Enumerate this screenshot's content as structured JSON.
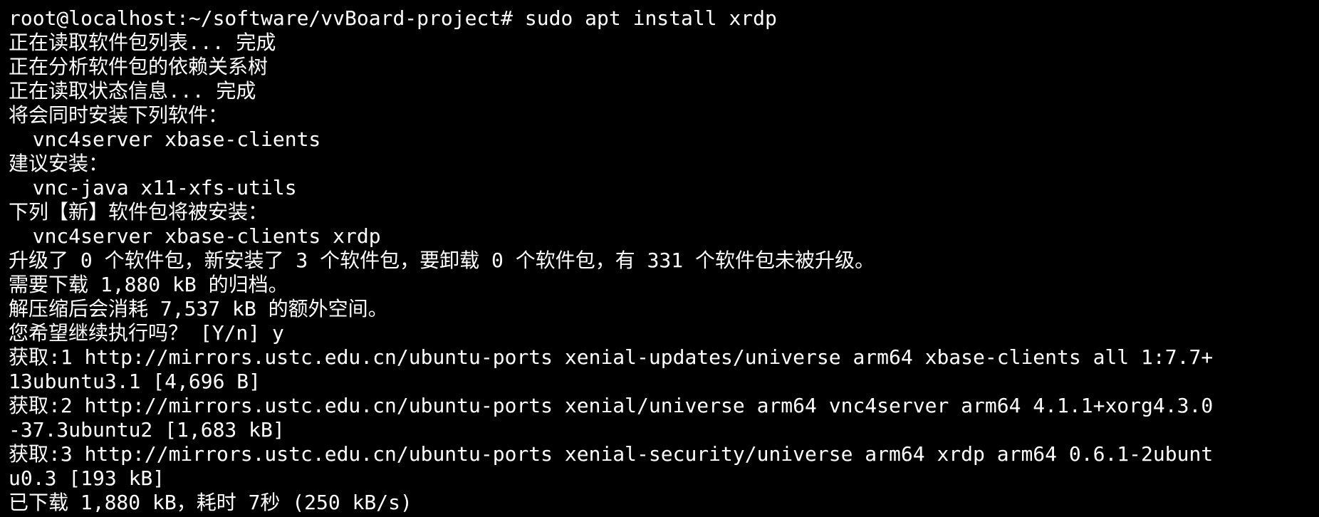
{
  "terminal": {
    "background_color": "#000000",
    "text_color": "#ffffff",
    "lines": [
      "root@localhost:~/software/vvBoard-project# sudo apt install xrdp",
      "正在读取软件包列表... 完成",
      "正在分析软件包的依赖关系树",
      "正在读取状态信息... 完成",
      "将会同时安装下列软件：",
      "  vnc4server xbase-clients",
      "建议安装：",
      "  vnc-java x11-xfs-utils",
      "下列【新】软件包将被安装：",
      "  vnc4server xbase-clients xrdp",
      "升级了 0 个软件包，新安装了 3 个软件包，要卸载 0 个软件包，有 331 个软件包未被升级。",
      "需要下载 1,880 kB 的归档。",
      "解压缩后会消耗 7,537 kB 的额外空间。",
      "您希望继续执行吗？ [Y/n] y",
      "获取:1 http://mirrors.ustc.edu.cn/ubuntu-ports xenial-updates/universe arm64 xbase-clients all 1:7.7+",
      "13ubuntu3.1 [4,696 B]",
      "获取:2 http://mirrors.ustc.edu.cn/ubuntu-ports xenial/universe arm64 vnc4server arm64 4.1.1+xorg4.3.0",
      "-37.3ubuntu2 [1,683 kB]",
      "获取:3 http://mirrors.ustc.edu.cn/ubuntu-ports xenial-security/universe arm64 xrdp arm64 0.6.1-2ubunt",
      "u0.3 [193 kB]",
      "已下载 1,880 kB，耗时 7秒 (250 kB/s)"
    ]
  }
}
